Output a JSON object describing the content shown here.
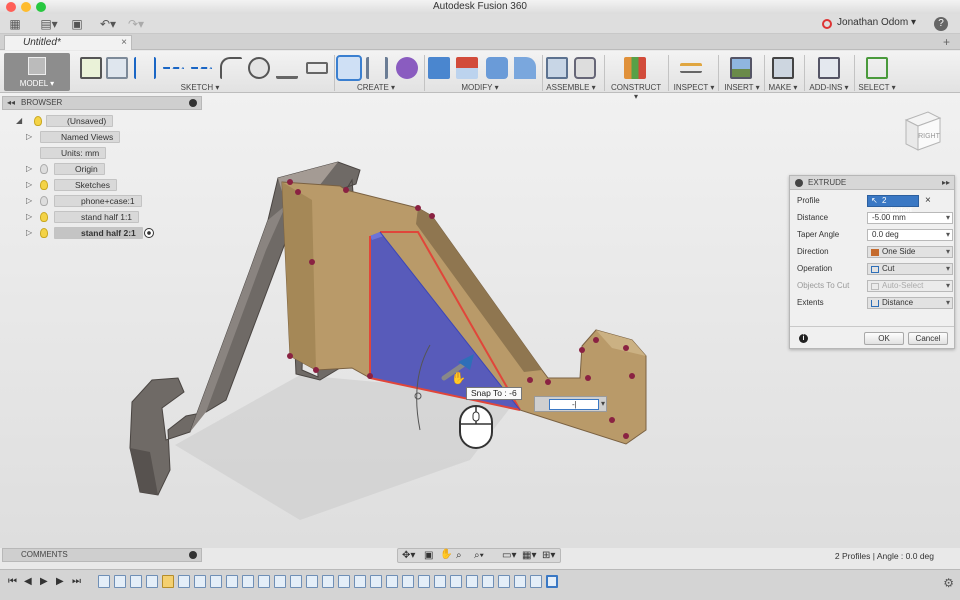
{
  "window": {
    "title": "Autodesk Fusion 360"
  },
  "header": {
    "user": "Jonathan Odom",
    "help": "?",
    "tab_title": "Untitled*",
    "tab_close": "×",
    "tab_add": "+"
  },
  "toolbar": {
    "workspace": "MODEL",
    "groups": [
      "SKETCH",
      "CREATE",
      "MODIFY",
      "ASSEMBLE",
      "CONSTRUCT",
      "INSPECT",
      "INSERT",
      "MAKE",
      "ADD-INS",
      "SELECT"
    ]
  },
  "browser": {
    "title": "BROWSER",
    "nodes": [
      {
        "label": "(Unsaved)"
      },
      {
        "label": "Named Views"
      },
      {
        "label": "Units: mm"
      },
      {
        "label": "Origin"
      },
      {
        "label": "Sketches"
      },
      {
        "label": "phone+case:1"
      },
      {
        "label": "stand half 1:1"
      },
      {
        "label": "stand half 2:1"
      }
    ]
  },
  "viewcube": {
    "face": "RIGHT"
  },
  "extrude": {
    "title": "EXTRUDE",
    "rows": [
      {
        "label": "Profile",
        "value": "2 selected",
        "clear": "×"
      },
      {
        "label": "Distance",
        "value": "-5.00 mm"
      },
      {
        "label": "Taper Angle",
        "value": "0.0 deg"
      },
      {
        "label": "Direction",
        "value": "One Side"
      },
      {
        "label": "Operation",
        "value": "Cut"
      },
      {
        "label": "Objects To Cut",
        "value": "Auto-Select"
      },
      {
        "label": "Extents",
        "value": "Distance"
      }
    ],
    "info": "i",
    "ok": "OK",
    "cancel": "Cancel"
  },
  "viewport": {
    "snap": "Snap To : -6",
    "distance_input": "-|"
  },
  "comments": {
    "title": "COMMENTS"
  },
  "status": {
    "text": "2 Profiles | Angle : 0.0 deg"
  },
  "colors": {
    "accent": "#3a78c4",
    "body": "#bb9a6a",
    "profile": "#4750c9",
    "edge": "#e0463a",
    "point": "#8a2242",
    "part": "#7a7470"
  }
}
